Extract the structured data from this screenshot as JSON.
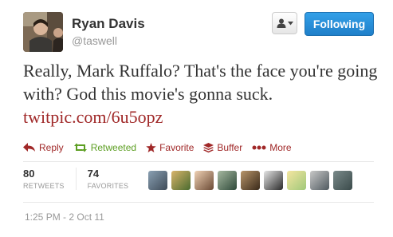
{
  "user": {
    "name": "Ryan Davis",
    "handle": "@taswell"
  },
  "buttons": {
    "following_label": "Following"
  },
  "tweet": {
    "text": "Really, Mark Ruffalo? That's the face you're going with? God this movie's gonna suck.",
    "link": "twitpic.com/6u5opz"
  },
  "actions": {
    "reply": "Reply",
    "retweeted": "Retweeted",
    "favorite": "Favorite",
    "buffer": "Buffer",
    "more": "More"
  },
  "stats": {
    "retweets_count": "80",
    "retweets_label": "RETWEETS",
    "favorites_count": "74",
    "favorites_label": "FAVORITES"
  },
  "timestamp": "1:25 PM - 2 Oct 11",
  "colors": {
    "action": "#a02828",
    "retweeted": "#5c9e22",
    "follow_button": "#2a8fd8"
  },
  "icons": {
    "reply": "reply-arrow-icon",
    "retweet": "retweet-icon",
    "favorite": "star-icon",
    "buffer": "buffer-stack-icon",
    "more": "more-dots-icon",
    "user_menu": "user-icon"
  }
}
